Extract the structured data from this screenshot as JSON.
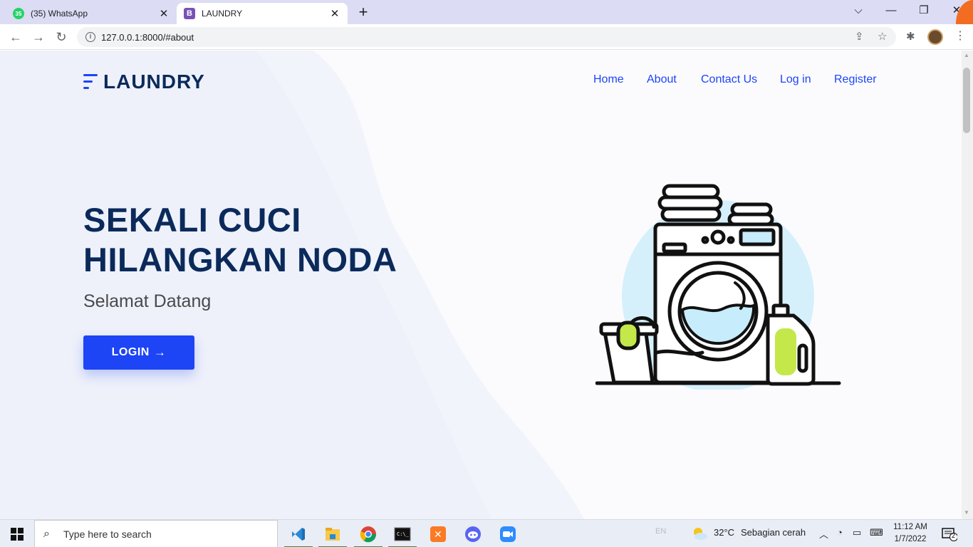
{
  "browser": {
    "tabs": [
      {
        "title": "(35) WhatsApp",
        "badge": "35",
        "active": false
      },
      {
        "title": "LAUNDRY",
        "badge": "B",
        "active": true
      }
    ],
    "new_tab": "+",
    "window_controls": {
      "dropdown": "⌵",
      "minimize": "—",
      "restore": "❐",
      "close": "✕"
    },
    "url": "127.0.0.1:8000/#about"
  },
  "site": {
    "brand": "LAUNDRY",
    "nav": [
      "Home",
      "About",
      "Contact Us",
      "Log in",
      "Register"
    ],
    "hero": {
      "title_line1": "SEKALI CUCI",
      "title_line2": "HILANGKAN NODA",
      "subtitle": "Selamat Datang",
      "cta": "LOGIN",
      "cta_arrow": "→"
    },
    "colors": {
      "primary": "#1d44f5",
      "heading": "#0b2a5b",
      "accent_green": "#c4e84a",
      "accent_blue": "#c7ecfb"
    }
  },
  "taskbar": {
    "search_placeholder": "Type here to search",
    "apps": [
      "vscode-icon",
      "file-explorer-icon",
      "chrome-icon",
      "terminal-icon",
      "xampp-icon",
      "discord-icon",
      "zoom-icon"
    ],
    "language": "EN",
    "weather_temp": "32°C",
    "weather_text": "Sebagian cerah",
    "time": "11:12 AM",
    "date": "1/7/2022",
    "notifications": "2"
  }
}
